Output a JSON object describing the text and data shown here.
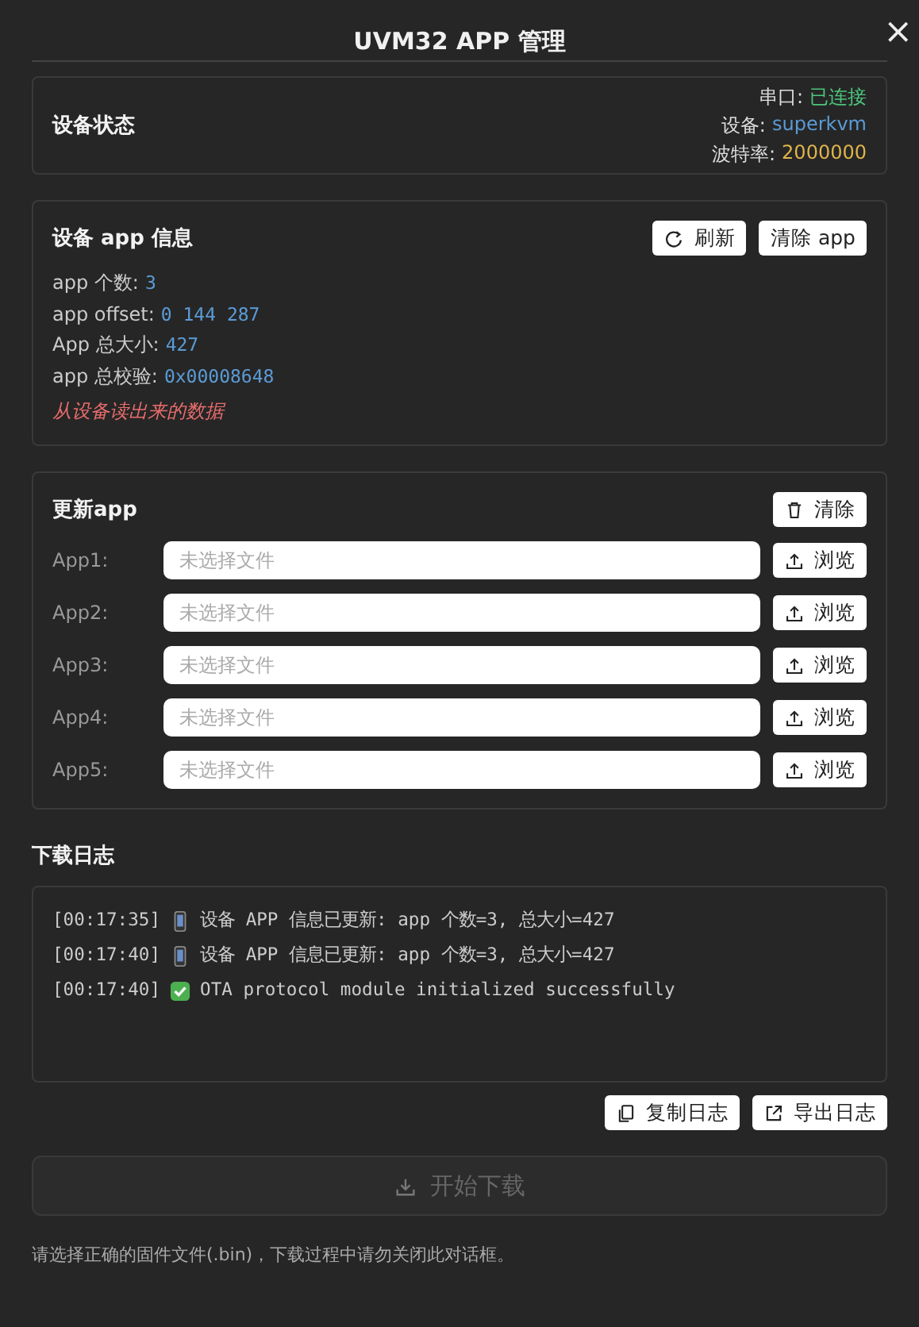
{
  "window": {
    "title": "UVM32 APP 管理",
    "close": "×"
  },
  "device_status": {
    "title": "设备状态",
    "items": [
      {
        "label": "串口:",
        "value": "已连接",
        "color": "#4cc47a"
      },
      {
        "label": "设备:",
        "value": "superkvm",
        "color": "#5b9bd5"
      },
      {
        "label": "波特率:",
        "value": "2000000",
        "color": "#e0b54a"
      }
    ]
  },
  "app_info": {
    "title": "设备 app 信息",
    "buttons": [
      {
        "label": "刷新",
        "kind": "refresh"
      },
      {
        "label": "清除 app",
        "kind": "plain"
      }
    ],
    "fields": [
      {
        "label": "app 个数:",
        "value": "3"
      },
      {
        "label": "app offset:",
        "value": "0 144 287"
      },
      {
        "label": "App 总大小:",
        "value": "427"
      },
      {
        "label": "app 总校验:",
        "value": "0x00008648"
      }
    ],
    "note": "从设备读出来的数据"
  },
  "update": {
    "title": "更新app",
    "clear_button": "清除",
    "rows": [
      {
        "label": "App1:",
        "placeholder": "未选择文件",
        "button": "浏览"
      },
      {
        "label": "App2:",
        "placeholder": "未选择文件",
        "button": "浏览"
      },
      {
        "label": "App3:",
        "placeholder": "未选择文件",
        "button": "浏览"
      },
      {
        "label": "App4:",
        "placeholder": "未选择文件",
        "button": "浏览"
      },
      {
        "label": "App5:",
        "placeholder": "未选择文件",
        "button": "浏览"
      }
    ]
  },
  "log": {
    "title": "下载日志",
    "entries": [
      {
        "time": "[00:17:35]",
        "kind": "device",
        "message": "设备 APP 信息已更新: app 个数=3, 总大小=427"
      },
      {
        "time": "[00:17:40]",
        "kind": "device",
        "message": "设备 APP 信息已更新: app 个数=3, 总大小=427"
      },
      {
        "time": "[00:17:40]",
        "kind": "success",
        "message": "OTA protocol module initialized successfully"
      }
    ],
    "buttons": [
      {
        "label": "复制日志",
        "kind": "copy"
      },
      {
        "label": "导出日志",
        "kind": "export"
      }
    ]
  },
  "start_button": {
    "label": "开始下载",
    "disabled": true
  },
  "footer_note": "请选择正确的固件文件(.bin)，下载过程中请勿关闭此对话框。"
}
